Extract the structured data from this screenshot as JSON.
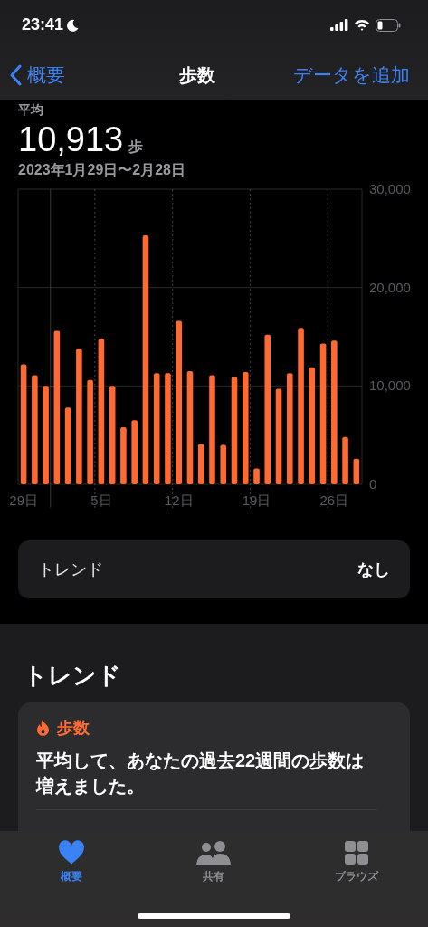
{
  "status_bar": {
    "time": "23:41"
  },
  "nav": {
    "back": "概要",
    "title": "歩数",
    "action": "データを追加"
  },
  "summary": {
    "label": "平均",
    "value": "10,913",
    "unit": "歩",
    "range": "2023年1月29日〜2月28日"
  },
  "chart_data": {
    "type": "bar",
    "values": [
      12200,
      11100,
      10000,
      15600,
      7800,
      13800,
      10600,
      14800,
      10000,
      5800,
      6500,
      25300,
      11300,
      11300,
      16600,
      11500,
      4100,
      11100,
      4000,
      10900,
      11400,
      1600,
      15200,
      9700,
      11300,
      15900,
      11900,
      14300,
      14600,
      4800,
      2600
    ],
    "ylim": [
      0,
      30000
    ],
    "yticks": [
      {
        "value": 0,
        "label": "0"
      },
      {
        "value": 10000,
        "label": "10,000"
      },
      {
        "value": 20000,
        "label": "20,000"
      },
      {
        "value": 30000,
        "label": "30,000"
      }
    ],
    "categories": [
      "29日",
      null,
      null,
      null,
      null,
      null,
      null,
      "5日",
      null,
      null,
      null,
      null,
      null,
      null,
      "12日",
      null,
      null,
      null,
      null,
      null,
      null,
      "19日",
      null,
      null,
      null,
      null,
      null,
      null,
      "26日",
      null,
      null
    ]
  },
  "trend_row": {
    "label": "トレンド",
    "value": "なし"
  },
  "trends": {
    "heading": "トレンド",
    "card": {
      "title": "歩数",
      "text": "平均して、あなたの過去22週間の歩数は増えました。"
    }
  },
  "tab_bar": [
    {
      "label": "概要",
      "selected": true
    },
    {
      "label": "共有",
      "selected": false
    },
    {
      "label": "ブラウズ",
      "selected": false
    }
  ]
}
